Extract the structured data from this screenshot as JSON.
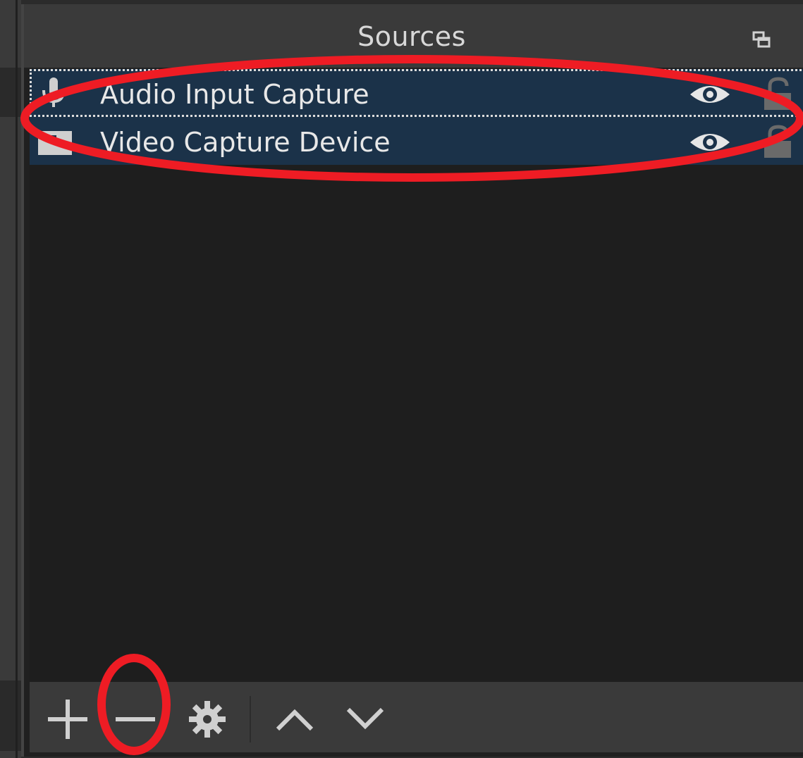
{
  "dock": {
    "title": "Sources"
  },
  "sources": [
    {
      "name": "Audio Input Capture",
      "icon": "microphone-icon",
      "visible": true,
      "locked": false,
      "focused": true
    },
    {
      "name": "Video Capture Device",
      "icon": "camera-icon",
      "visible": true,
      "locked": false,
      "focused": false
    }
  ],
  "toolbar": {
    "buttons": [
      {
        "name": "add-source-button",
        "icon": "plus-icon"
      },
      {
        "name": "remove-source-button",
        "icon": "minus-icon"
      },
      {
        "name": "source-properties-button",
        "icon": "gear-icon"
      },
      {
        "name": "move-up-button",
        "icon": "chevron-up-icon"
      },
      {
        "name": "move-down-button",
        "icon": "chevron-down-icon"
      }
    ]
  },
  "colors": {
    "selection": "#1b3249",
    "panel_bg": "#1e1e1e",
    "header_bg": "#3a3a3a",
    "annotation": "#ee1c24"
  }
}
